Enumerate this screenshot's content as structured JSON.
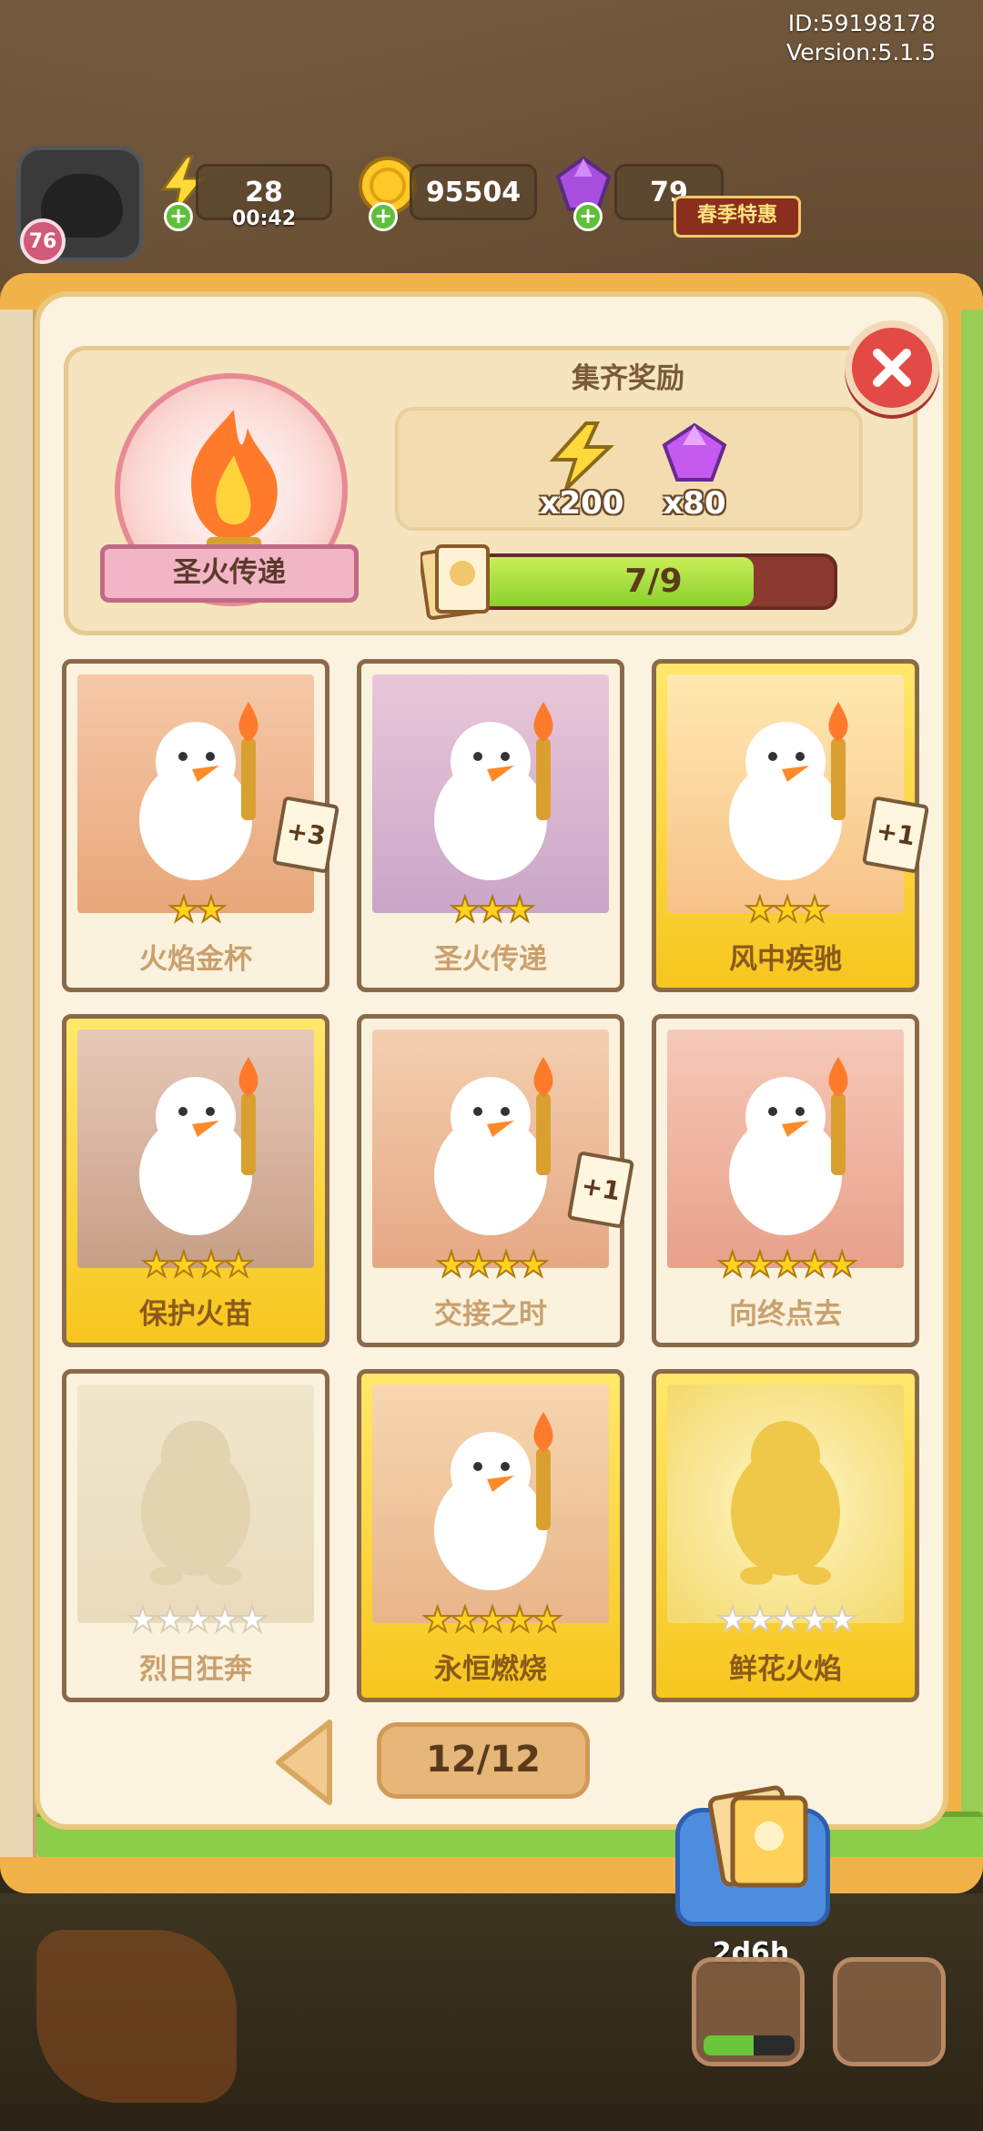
{
  "hud": {
    "id_text": "ID:59198178",
    "version_text": "Version:5.1.5"
  },
  "player": {
    "level": "76"
  },
  "resources": {
    "energy": "28",
    "energy_timer": "00:42",
    "coins": "95504",
    "gems": "79",
    "spring_sale": "春季特惠"
  },
  "collection": {
    "emblem_name": "圣火传递",
    "reward_title": "集齐奖励",
    "rewards": [
      {
        "icon": "lightning-icon",
        "amount": "x200"
      },
      {
        "icon": "gem-icon",
        "amount": "x80"
      }
    ],
    "progress_text": "7/9",
    "progress_fraction": 0.778
  },
  "cards": [
    {
      "name": "火焰金杯",
      "stars": 2,
      "max_stars": 2,
      "gold": false,
      "dup": "+3"
    },
    {
      "name": "圣火传递",
      "stars": 3,
      "max_stars": 3,
      "gold": false,
      "dup": ""
    },
    {
      "name": "风中疾驰",
      "stars": 3,
      "max_stars": 3,
      "gold": true,
      "dup": "+1"
    },
    {
      "name": "保护火苗",
      "stars": 4,
      "max_stars": 4,
      "gold": true,
      "dup": ""
    },
    {
      "name": "交接之时",
      "stars": 4,
      "max_stars": 4,
      "gold": false,
      "dup": "+1"
    },
    {
      "name": "向终点去",
      "stars": 5,
      "max_stars": 5,
      "gold": false,
      "dup": ""
    },
    {
      "name": "烈日狂奔",
      "stars": 0,
      "max_stars": 5,
      "gold": false,
      "dup": ""
    },
    {
      "name": "永恒燃烧",
      "stars": 5,
      "max_stars": 5,
      "gold": true,
      "dup": ""
    },
    {
      "name": "鲜花火焰",
      "stars": 0,
      "max_stars": 5,
      "gold": true,
      "dup": ""
    }
  ],
  "pagination": {
    "page_text": "12/12"
  },
  "album": {
    "timer": "2d6h",
    "progress_fraction": 0.55
  },
  "colors": {
    "panel_bg": "#fbf3df",
    "gold_card": "#f7c61e",
    "progress_fill": "#8cd02e",
    "progress_track": "#8a3a30",
    "close_red": "#e34a45"
  }
}
